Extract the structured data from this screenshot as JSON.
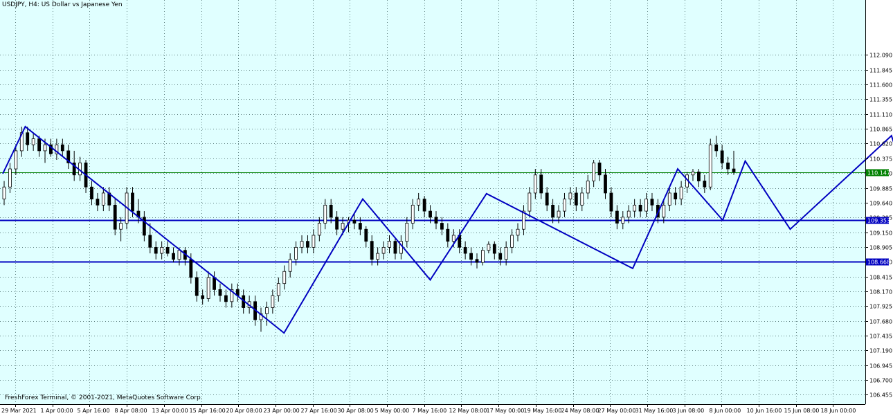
{
  "window": {
    "title": "USDJPY, H4:  US Dollar vs Japanese Yen",
    "copyright": "FreshForex Terminal, © 2001-2021, MetaQuotes Software Corp."
  },
  "colors": {
    "background": "#e0ffff",
    "grid": "#5f7f7f",
    "candle": "#000000",
    "trendline": "#0000c0",
    "current_price_line": "#008000",
    "label_bg": "#0000c0"
  },
  "chart_data": {
    "type": "candlestick",
    "symbol": "USDJPY",
    "timeframe": "H4",
    "title": "USDJPY, H4:  US Dollar vs Japanese Yen",
    "ylim": [
      106.3,
      113.0
    ],
    "x_tick_labels": [
      "29 Mar 2021",
      "1 Apr 00:00",
      "5 Apr 16:00",
      "8 Apr 08:00",
      "13 Apr 00:00",
      "15 Apr 16:00",
      "20 Apr 08:00",
      "23 Apr 00:00",
      "27 Apr 16:00",
      "30 Apr 08:00",
      "5 May 00:00",
      "7 May 16:00",
      "12 May 08:00",
      "17 May 00:00",
      "19 May 16:00",
      "24 May 08:00",
      "27 May 00:00",
      "31 May 16:00",
      "3 Jun 08:00",
      "8 Jun 00:00",
      "10 Jun 16:00",
      "15 Jun 08:00",
      "18 Jun 00:00"
    ],
    "y_ticks": [
      106.455,
      106.7,
      106.945,
      107.19,
      107.435,
      107.68,
      107.925,
      108.17,
      108.415,
      108.66,
      108.905,
      109.15,
      109.395,
      109.64,
      109.885,
      110.13,
      110.375,
      110.62,
      110.865,
      111.11,
      111.355,
      111.6,
      111.845,
      112.09
    ],
    "y_tick_labels": [
      "106.455",
      "106.700",
      "106.945",
      "107.190",
      "107.435",
      "107.680",
      "107.925",
      "108.170",
      "108.415",
      "108.660",
      "108.905",
      "109.150",
      "109.395",
      "109.640",
      "109.885",
      "110.130",
      "110.375",
      "110.620",
      "110.865",
      "111.110",
      "111.355",
      "111.600",
      "111.845",
      "112.090"
    ],
    "price_markers": [
      {
        "label": "110.147",
        "value": 110.147,
        "kind": "current"
      },
      {
        "label": "109.353",
        "value": 109.353,
        "kind": "horizontal-line"
      },
      {
        "label": "108.668",
        "value": 108.668,
        "kind": "horizontal-line"
      }
    ],
    "zigzag_points": [
      {
        "date": "29 Mar 2021",
        "value": 110.12
      },
      {
        "date": "31 Mar 2021",
        "value": 110.9
      },
      {
        "date": "23 Apr 2021",
        "value": 107.48
      },
      {
        "date": "30 Apr 2021",
        "value": 109.7
      },
      {
        "date": "6 May 2021",
        "value": 108.36
      },
      {
        "date": "11 May 2021",
        "value": 109.79
      },
      {
        "date": "24 May 2021",
        "value": 108.55
      },
      {
        "date": "28 May 2021",
        "value": 110.2
      },
      {
        "date": "1 Jun 2021",
        "value": 109.35
      },
      {
        "date": "3 Jun 2021",
        "value": 110.33
      },
      {
        "date": "7 Jun 2021",
        "value": 109.2
      },
      {
        "date": "16 Jun 2021",
        "value": 110.75
      },
      {
        "date": "18 Jun 2021",
        "value": 109.6
      }
    ],
    "projection": [
      {
        "date": "19 Jun 2021",
        "value": 109.55
      },
      {
        "date": "21 Jun 2021",
        "value": 110.6
      }
    ],
    "candles_ohlc": [
      [
        109.7,
        110.0,
        109.6,
        109.9
      ],
      [
        109.9,
        110.3,
        109.8,
        110.2
      ],
      [
        110.2,
        110.6,
        110.1,
        110.5
      ],
      [
        110.5,
        110.9,
        110.4,
        110.8
      ],
      [
        110.8,
        110.9,
        110.5,
        110.6
      ],
      [
        110.6,
        110.8,
        110.5,
        110.7
      ],
      [
        110.7,
        110.75,
        110.4,
        110.5
      ],
      [
        110.5,
        110.7,
        110.3,
        110.6
      ],
      [
        110.6,
        110.7,
        110.4,
        110.45
      ],
      [
        110.45,
        110.7,
        110.35,
        110.6
      ],
      [
        110.6,
        110.7,
        110.4,
        110.5
      ],
      [
        110.5,
        110.6,
        110.2,
        110.3
      ],
      [
        110.3,
        110.5,
        110.0,
        110.1
      ],
      [
        110.1,
        110.4,
        110.0,
        110.3
      ],
      [
        110.3,
        110.35,
        109.8,
        109.9
      ],
      [
        109.9,
        110.0,
        109.6,
        109.7
      ],
      [
        109.7,
        109.8,
        109.5,
        109.6
      ],
      [
        109.6,
        109.9,
        109.5,
        109.8
      ],
      [
        109.8,
        109.9,
        109.5,
        109.6
      ],
      [
        109.6,
        109.7,
        109.1,
        109.2
      ],
      [
        109.2,
        109.4,
        109.0,
        109.3
      ],
      [
        109.3,
        109.9,
        109.2,
        109.8
      ],
      [
        109.8,
        109.9,
        109.4,
        109.5
      ],
      [
        109.5,
        109.7,
        109.3,
        109.4
      ],
      [
        109.4,
        109.5,
        109.0,
        109.1
      ],
      [
        109.1,
        109.3,
        108.8,
        108.9
      ],
      [
        108.9,
        109.0,
        108.7,
        108.8
      ],
      [
        108.8,
        109.0,
        108.7,
        108.9
      ],
      [
        108.9,
        109.0,
        108.75,
        108.8
      ],
      [
        108.8,
        108.9,
        108.65,
        108.7
      ],
      [
        108.7,
        108.9,
        108.6,
        108.85
      ],
      [
        108.85,
        108.9,
        108.6,
        108.7
      ],
      [
        108.7,
        108.8,
        108.3,
        108.4
      ],
      [
        108.4,
        108.5,
        108.0,
        108.1
      ],
      [
        108.1,
        108.2,
        107.95,
        108.05
      ],
      [
        108.05,
        108.5,
        108.0,
        108.4
      ],
      [
        108.4,
        108.5,
        108.1,
        108.2
      ],
      [
        108.2,
        108.3,
        108.0,
        108.1
      ],
      [
        108.1,
        108.2,
        107.9,
        108.0
      ],
      [
        108.0,
        108.3,
        107.9,
        108.2
      ],
      [
        108.2,
        108.3,
        108.0,
        108.1
      ],
      [
        108.1,
        108.2,
        107.8,
        107.9
      ],
      [
        107.9,
        108.1,
        107.8,
        108.0
      ],
      [
        108.0,
        108.1,
        107.6,
        107.7
      ],
      [
        107.7,
        107.9,
        107.5,
        107.8
      ],
      [
        107.8,
        108.0,
        107.6,
        107.9
      ],
      [
        107.9,
        108.2,
        107.8,
        108.1
      ],
      [
        108.1,
        108.4,
        108.0,
        108.3
      ],
      [
        108.3,
        108.6,
        108.2,
        108.5
      ],
      [
        108.5,
        108.8,
        108.4,
        108.7
      ],
      [
        108.7,
        109.0,
        108.6,
        108.9
      ],
      [
        108.9,
        109.1,
        108.8,
        109.0
      ],
      [
        109.0,
        109.1,
        108.8,
        108.9
      ],
      [
        108.9,
        109.2,
        108.8,
        109.1
      ],
      [
        109.1,
        109.4,
        109.0,
        109.3
      ],
      [
        109.3,
        109.7,
        109.2,
        109.6
      ],
      [
        109.6,
        109.7,
        109.3,
        109.4
      ],
      [
        109.4,
        109.5,
        109.1,
        109.2
      ],
      [
        109.2,
        109.4,
        109.1,
        109.3
      ],
      [
        109.3,
        109.4,
        109.15,
        109.35
      ],
      [
        109.35,
        109.45,
        109.2,
        109.3
      ],
      [
        109.3,
        109.4,
        109.1,
        109.2
      ],
      [
        109.2,
        109.25,
        108.9,
        109.0
      ],
      [
        109.0,
        109.1,
        108.6,
        108.7
      ],
      [
        108.7,
        108.9,
        108.6,
        108.8
      ],
      [
        108.8,
        109.0,
        108.7,
        108.9
      ],
      [
        108.9,
        109.1,
        108.8,
        109.0
      ],
      [
        109.0,
        109.05,
        108.7,
        108.8
      ],
      [
        108.8,
        109.1,
        108.7,
        109.0
      ],
      [
        109.0,
        109.4,
        108.9,
        109.3
      ],
      [
        109.3,
        109.7,
        109.2,
        109.6
      ],
      [
        109.6,
        109.8,
        109.5,
        109.7
      ],
      [
        109.7,
        109.75,
        109.4,
        109.5
      ],
      [
        109.5,
        109.6,
        109.3,
        109.4
      ],
      [
        109.4,
        109.5,
        109.2,
        109.3
      ],
      [
        109.3,
        109.4,
        109.1,
        109.2
      ],
      [
        109.2,
        109.3,
        108.9,
        109.0
      ],
      [
        109.0,
        109.2,
        108.9,
        109.1
      ],
      [
        109.1,
        109.2,
        108.8,
        108.9
      ],
      [
        108.9,
        109.0,
        108.7,
        108.8
      ],
      [
        108.8,
        108.9,
        108.6,
        108.7
      ],
      [
        108.7,
        108.8,
        108.55,
        108.65
      ],
      [
        108.65,
        108.9,
        108.6,
        108.85
      ],
      [
        108.85,
        109.0,
        108.8,
        108.95
      ],
      [
        108.95,
        109.0,
        108.7,
        108.8
      ],
      [
        108.8,
        108.9,
        108.6,
        108.7
      ],
      [
        108.7,
        109.0,
        108.6,
        108.9
      ],
      [
        108.9,
        109.2,
        108.8,
        109.1
      ],
      [
        109.1,
        109.3,
        109.0,
        109.2
      ],
      [
        109.2,
        109.6,
        109.1,
        109.5
      ],
      [
        109.5,
        109.9,
        109.4,
        109.8
      ],
      [
        109.8,
        110.2,
        109.7,
        110.1
      ],
      [
        110.1,
        110.2,
        109.7,
        109.8
      ],
      [
        109.8,
        109.9,
        109.5,
        109.6
      ],
      [
        109.6,
        109.7,
        109.3,
        109.4
      ],
      [
        109.4,
        109.6,
        109.3,
        109.5
      ],
      [
        109.5,
        109.8,
        109.4,
        109.7
      ],
      [
        109.7,
        109.9,
        109.6,
        109.8
      ],
      [
        109.8,
        109.9,
        109.5,
        109.6
      ],
      [
        109.6,
        109.9,
        109.5,
        109.8
      ],
      [
        109.8,
        110.1,
        109.7,
        110.0
      ],
      [
        110.0,
        110.35,
        109.9,
        110.3
      ],
      [
        110.3,
        110.35,
        110.0,
        110.1
      ],
      [
        110.1,
        110.2,
        109.7,
        109.8
      ],
      [
        109.8,
        109.9,
        109.4,
        109.5
      ],
      [
        109.5,
        109.6,
        109.2,
        109.3
      ],
      [
        109.3,
        109.5,
        109.2,
        109.4
      ],
      [
        109.4,
        109.6,
        109.3,
        109.5
      ],
      [
        109.5,
        109.7,
        109.4,
        109.6
      ],
      [
        109.6,
        109.7,
        109.4,
        109.5
      ],
      [
        109.5,
        109.8,
        109.4,
        109.7
      ],
      [
        109.7,
        109.8,
        109.5,
        109.6
      ],
      [
        109.6,
        109.7,
        109.3,
        109.4
      ],
      [
        109.4,
        109.7,
        109.3,
        109.6
      ],
      [
        109.6,
        109.9,
        109.5,
        109.8
      ],
      [
        109.8,
        109.9,
        109.6,
        109.7
      ],
      [
        109.7,
        110.0,
        109.6,
        109.9
      ],
      [
        109.9,
        110.15,
        109.8,
        110.1
      ],
      [
        110.1,
        110.2,
        110.0,
        110.15
      ],
      [
        110.15,
        110.2,
        109.9,
        110.0
      ],
      [
        110.0,
        110.1,
        109.8,
        109.9
      ],
      [
        109.9,
        110.7,
        109.85,
        110.6
      ],
      [
        110.6,
        110.75,
        110.4,
        110.5
      ],
      [
        110.5,
        110.6,
        110.2,
        110.3
      ],
      [
        110.3,
        110.4,
        110.1,
        110.2
      ],
      [
        110.2,
        110.5,
        110.1,
        110.15
      ]
    ]
  }
}
